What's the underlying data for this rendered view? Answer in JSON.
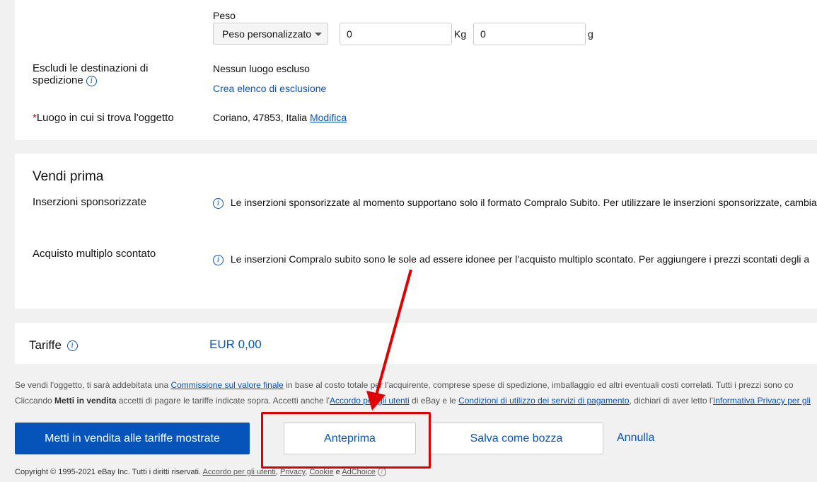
{
  "shipping": {
    "weight_label": "Peso",
    "weight_select": "Peso personalizzato",
    "kg_value": "0",
    "kg_unit": "Kg",
    "g_value": "0",
    "g_unit": "g",
    "exclude_label_line1": "Escludi le destinazioni di",
    "exclude_label_line2": "spedizione",
    "exclude_value": "Nessun luogo escluso",
    "exclude_link": "Crea elenco di esclusione",
    "location_required_mark": "*",
    "location_label": "Luogo in cui si trova l'oggetto",
    "location_value": "Coriano, 47853, Italia",
    "location_edit": "Modifica"
  },
  "sell_faster": {
    "title": "Vendi prima",
    "sponsored_label": "Inserzioni sponsorizzate",
    "sponsored_text": "Le inserzioni sponsorizzate al momento supportano solo il formato Compralo Subito. Per utilizzare le inserzioni sponsorizzate, cambia",
    "volume_label": "Acquisto multiplo scontato",
    "volume_text": "Le inserzioni Compralo subito sono le sole ad essere idonee per l'acquisto multiplo scontato. Per aggiungere i prezzi scontati degli a"
  },
  "fees": {
    "label": "Tariffe",
    "value": "EUR 0,00"
  },
  "legal": {
    "line1_a": "Se vendi l'oggetto, ti sarà addebitata una ",
    "line1_link": "Commissione sul valore finale",
    "line1_b": " in base al costo totale per l'acquirente, comprese spese di spedizione, imballaggio ed altri eventuali costi correlati. Tutti i prezzi sono co",
    "line2_a": "Cliccando ",
    "line2_bold": "Metti in vendita",
    "line2_b": " accetti di pagare le tariffe indicate sopra. Accetti anche l'",
    "line2_link1": "Accordo per gli utenti",
    "line2_c": " di eBay e le ",
    "line2_link2": "Condizioni di utilizzo dei servizi di pagamento",
    "line2_d": ", dichiari di aver letto l'",
    "line2_link3": "Informativa Privacy per gli"
  },
  "actions": {
    "list_button": "Metti in vendita alle tariffe mostrate",
    "preview_button": "Anteprima",
    "draft_button": "Salva come bozza",
    "cancel_link": "Annulla"
  },
  "footer": {
    "copyright": "Copyright © 1995-2021 eBay Inc. Tutti i diritti riservati. ",
    "link_agreement": "Accordo per gli utenti",
    "link_privacy": "Privacy",
    "link_cookie": "Cookie",
    "and": " e ",
    "link_adchoice": "AdChoice"
  },
  "colors": {
    "brand_blue": "#0654ba",
    "annotation_red": "#e10000",
    "background": "#f1f1f1"
  }
}
